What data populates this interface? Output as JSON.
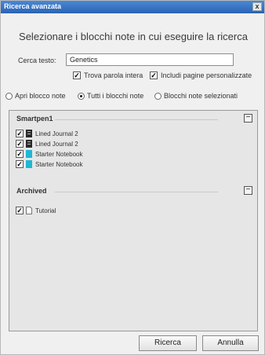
{
  "window": {
    "title": "Ricerca avanzata",
    "close_label": "x"
  },
  "heading": "Selezionare i blocchi note in cui eseguire la ricerca",
  "search": {
    "label": "Cerca testo:",
    "value": "Genetics"
  },
  "options": {
    "whole_word": {
      "label": "Trova parola intera",
      "checked": true
    },
    "custom_pages": {
      "label": "Includi pagine personalizzate",
      "checked": true
    }
  },
  "scope": [
    {
      "label": "Apri blocco note",
      "selected": false
    },
    {
      "label": "Tutti i blocchi note",
      "selected": true
    },
    {
      "label": "Blocchi note selezionati",
      "selected": false
    }
  ],
  "groups": [
    {
      "title": "Smartpen1",
      "collapse_symbol": "−",
      "items": [
        {
          "label": "Lined Journal 2",
          "checked": true,
          "icon": "dark-notebook-icon"
        },
        {
          "label": "Lined Journal 2",
          "checked": true,
          "icon": "dark-notebook-icon"
        },
        {
          "label": "Starter Notebook",
          "checked": true,
          "icon": "cyan-notebook-icon"
        },
        {
          "label": "Starter Notebook",
          "checked": true,
          "icon": "cyan-notebook-icon"
        }
      ]
    },
    {
      "title": "Archived",
      "collapse_symbol": "−",
      "items": [
        {
          "label": "Tutorial",
          "checked": true,
          "icon": "document-icon"
        }
      ]
    }
  ],
  "buttons": {
    "search": "Ricerca",
    "cancel": "Annulla"
  },
  "check_mark": "✓",
  "colors": {
    "titlebar": "#2a63b4",
    "cyan_notebook": "#1fb8d6",
    "dark_notebook": "#2a2a2a"
  }
}
